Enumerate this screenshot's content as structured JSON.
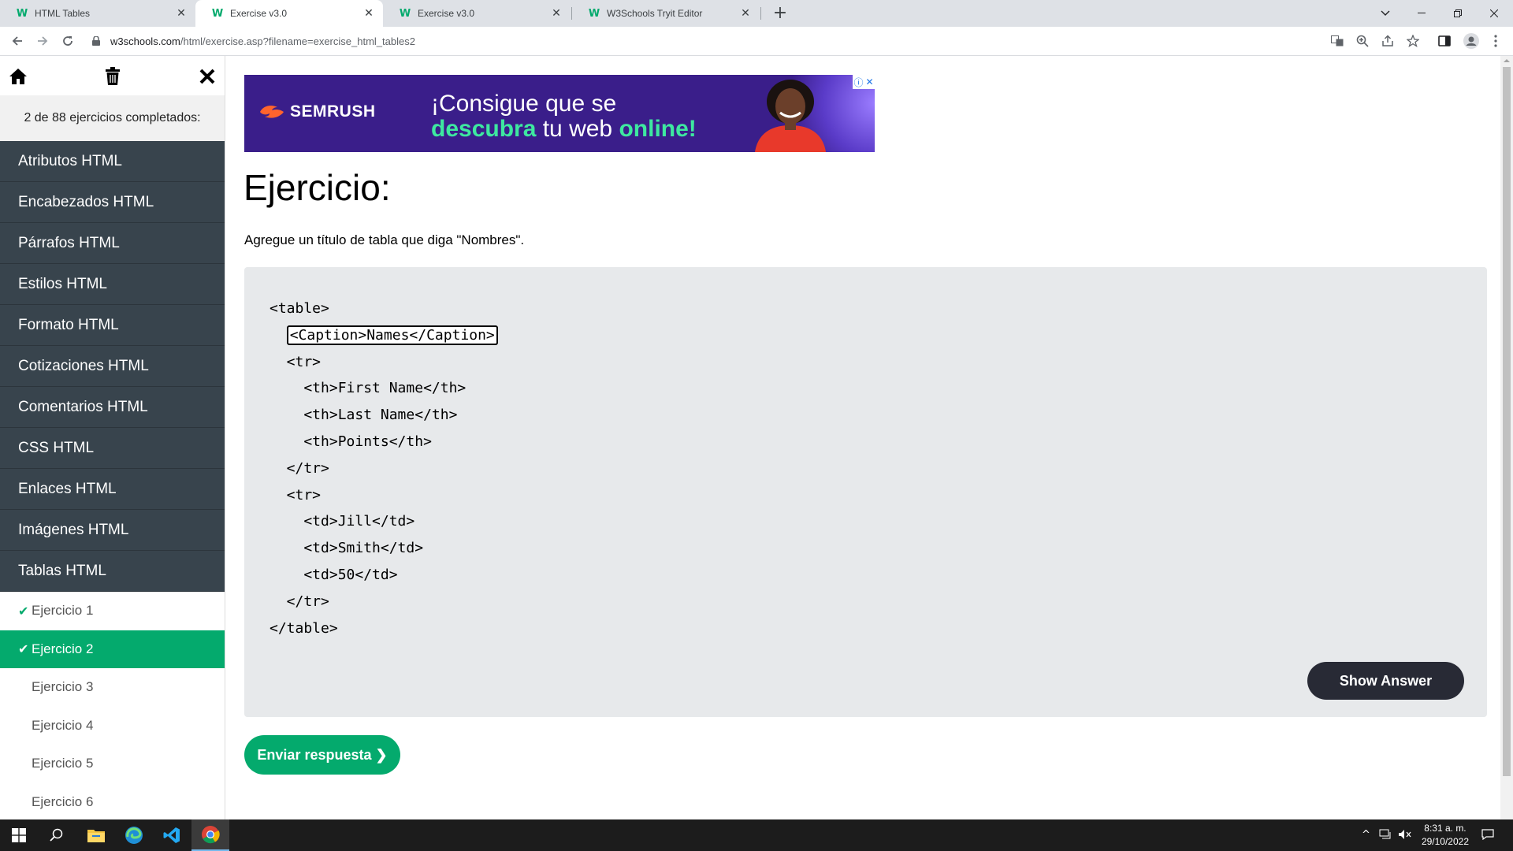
{
  "browser": {
    "tabs": [
      {
        "title": "HTML Tables",
        "favicon": "W",
        "active": false
      },
      {
        "title": "Exercise v3.0",
        "favicon": "W",
        "active": true
      },
      {
        "title": "Exercise v3.0",
        "favicon": "W",
        "active": false
      },
      {
        "title": "W3Schools Tryit Editor",
        "favicon": "W",
        "active": false
      }
    ],
    "new_tab": "+",
    "url_domain": "w3schools.com",
    "url_path": "/html/exercise.asp?filename=exercise_html_tables2"
  },
  "sidebar": {
    "progress_text": "2 de 88 ejercicios completados:",
    "categories": [
      "Atributos HTML",
      "Encabezados HTML",
      "Párrafos HTML",
      "Estilos HTML",
      "Formato HTML",
      "Cotizaciones HTML",
      "Comentarios HTML",
      "CSS HTML",
      "Enlaces HTML",
      "Imágenes HTML",
      "Tablas HTML"
    ],
    "exercises": [
      {
        "label": "Ejercicio 1",
        "completed": true,
        "current": false
      },
      {
        "label": "Ejercicio 2",
        "completed": true,
        "current": true
      },
      {
        "label": "Ejercicio 3",
        "completed": false,
        "current": false
      },
      {
        "label": "Ejercicio 4",
        "completed": false,
        "current": false
      },
      {
        "label": "Ejercicio 5",
        "completed": false,
        "current": false
      },
      {
        "label": "Ejercicio 6",
        "completed": false,
        "current": false
      }
    ]
  },
  "ad": {
    "brand": "SEMRUSH",
    "line1": "¡Consigue que se",
    "line2_part1": "descubra",
    "line2_part2": " tu web ",
    "line2_part3": "online!"
  },
  "exercise": {
    "title": "Ejercicio:",
    "instruction": "Agregue un título de tabla que diga \"Nombres\".",
    "code_before": "<table>",
    "answer_value": "<Caption>Names</Caption>",
    "code_after": [
      "  <tr>",
      "    <th>First Name</th>",
      "    <th>Last Name</th>",
      "    <th>Points</th>",
      "  </tr>",
      "  <tr>",
      "    <td>Jill</td>",
      "    <td>Smith</td>",
      "    <td>50</td>",
      "  </tr>",
      "</table>"
    ],
    "show_answer": "Show Answer",
    "submit": "Enviar respuesta ❯"
  },
  "taskbar": {
    "time": "8:31 a. m.",
    "date": "29/10/2022"
  },
  "colors": {
    "w3_green": "#04aa6d",
    "sidebar_dark": "#38444d",
    "button_dark": "#282a35",
    "code_bg": "#e7e9eb"
  }
}
